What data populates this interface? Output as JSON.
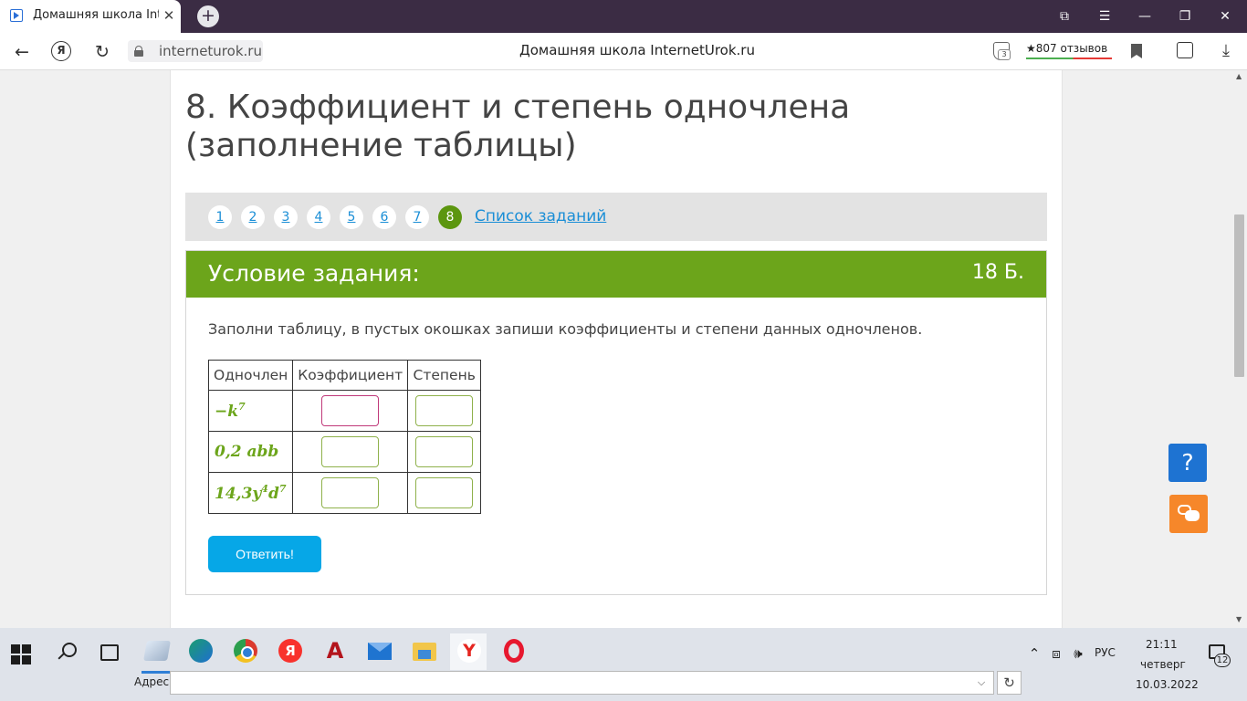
{
  "browser": {
    "tab_title": "Домашняя школа InternetUrok.ru",
    "tab_close": "✕",
    "new_tab": "+",
    "url": "interneturok.ru",
    "page_title": "Домашняя школа InternetUrok.ru",
    "protect_count": "3",
    "reviews": "★807 отзывов",
    "icons": {
      "back": "←",
      "yandex": "Я",
      "reload": "↻",
      "download": "⤓",
      "bookmarks": "⧉",
      "menu": "☰",
      "minimize": "—",
      "restore": "❐",
      "close": "✕"
    }
  },
  "lesson": {
    "title": "8. Коэффициент и степень одночлена (заполнение таблицы)",
    "pages": [
      "1",
      "2",
      "3",
      "4",
      "5",
      "6",
      "7",
      "8"
    ],
    "active_page": "8",
    "task_list": "Список заданий"
  },
  "task": {
    "header": "Условие задания:",
    "points": "18 Б.",
    "text": "Заполни таблицу, в пустых окошках запиши коэффициенты и степени данных одночленов.",
    "table": {
      "headers": [
        "Одночлен",
        "Коэффициент",
        "Степень"
      ],
      "rows": [
        {
          "base": "−k",
          "exp": "7",
          "rest": ""
        },
        {
          "base": "0,2 abb",
          "exp": "",
          "rest": ""
        },
        {
          "base": "14,3y",
          "exp": "4",
          "rest": "d",
          "exp2": "7"
        }
      ]
    },
    "submit": "Ответить!"
  },
  "side_buttons": {
    "help": "?"
  },
  "taskbar": {
    "address_label": "Адрес",
    "lang": "РУС",
    "time": "21:11",
    "day": "четверг",
    "date": "10.03.2022",
    "notifications": "12",
    "tray": {
      "up": "⌃",
      "network": "⧈",
      "volume": "🕪"
    }
  }
}
